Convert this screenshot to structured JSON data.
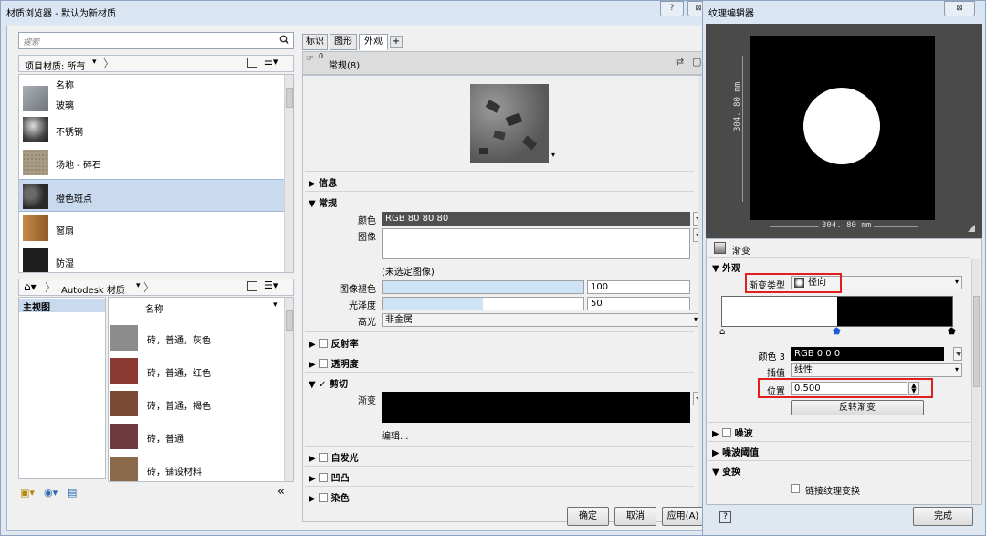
{
  "main_window": {
    "title": "材质浏览器 - 默认为新材质",
    "help": "?",
    "close": "⊠"
  },
  "browser": {
    "search_placeholder": "搜索",
    "project_label": "项目材质: 所有",
    "column_name": "名称",
    "materials": [
      {
        "name": "玻璃",
        "color": "#8a8f94"
      },
      {
        "name": "不锈钢",
        "color": "#5c5c5c"
      },
      {
        "name": "场地 - 碎石",
        "color": "#a89c84"
      },
      {
        "name": "橙色斑点",
        "color": "#3c3c3c",
        "selected": true
      },
      {
        "name": "窗扇",
        "color": "#b6793a"
      },
      {
        "name": "防湿",
        "color": "#202020"
      }
    ],
    "library_label": "Autodesk 材质",
    "tree_root": "主视图",
    "lib_column_name": "名称",
    "library": [
      {
        "name": "砖，普通，灰色",
        "color": "#8c8c8c"
      },
      {
        "name": "砖，普通，红色",
        "color": "#8a3a32"
      },
      {
        "name": "砖，普通，褐色",
        "color": "#7a4a35"
      },
      {
        "name": "砖，普通",
        "color": "#6e3a3e"
      },
      {
        "name": "砖，铺设材料",
        "color": "#8a6a4a"
      }
    ],
    "collapse": "«"
  },
  "editor": {
    "tabs": [
      "标识",
      "图形",
      "外观",
      "+"
    ],
    "asset_title": "常规(8)",
    "asset_count": "0",
    "sections": {
      "info": "信息",
      "generic": "常规",
      "reflectivity": "反射率",
      "transparency": "透明度",
      "cutout": "剪切",
      "self_illum": "自发光",
      "bump": "凹凸",
      "tint": "染色"
    },
    "color_label": "颜色",
    "color_value": "RGB 80 80 80",
    "image_label": "图像",
    "image_none": "(未选定图像)",
    "fade_label": "图像褪色",
    "fade_value": "100",
    "fade_fill": 1.0,
    "gloss_label": "光泽度",
    "gloss_value": "50",
    "gloss_fill": 0.5,
    "highlight_label": "高光",
    "highlight_value": "非金属",
    "cutout_gradient_label": "渐变",
    "edit_link": "编辑..."
  },
  "buttons": {
    "ok": "确定",
    "cancel": "取消",
    "apply": "应用(A)"
  },
  "texture_editor": {
    "title": "纹理编辑器",
    "close": "⊠",
    "dim_v": "304. 80 mm",
    "dim_h": "304. 80 mm",
    "gradient_label": "渐变",
    "appearance": "外观",
    "gradient_type_label": "渐变类型",
    "gradient_type_value": "径向",
    "color_label": "颜色 3",
    "color_value": "RGB 0 0 0",
    "interp_label": "插值",
    "interp_value": "线性",
    "position_label": "位置",
    "position_value": "0.500",
    "stop_position": 0.5,
    "reverse_button": "反转渐变",
    "noise": "噪波",
    "noise_threshold": "噪波阈值",
    "transform": "变换",
    "link_transform": "链接纹理变换",
    "help": "?",
    "done": "完成"
  }
}
